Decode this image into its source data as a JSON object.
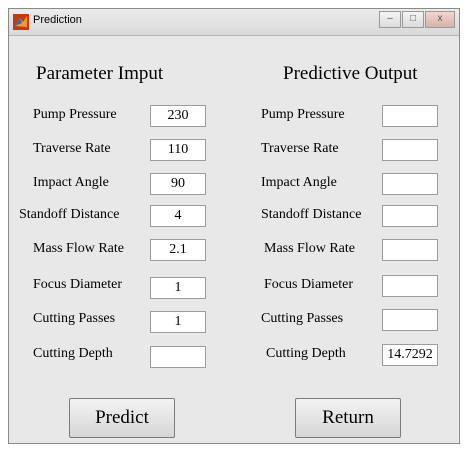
{
  "window": {
    "title": "Prediction"
  },
  "titlebar_buttons": {
    "minimize": "–",
    "maximize": "□",
    "close": "x"
  },
  "input": {
    "heading": "Parameter Imput",
    "rows": [
      {
        "label": "Pump Pressure",
        "value": "230"
      },
      {
        "label": "Traverse Rate",
        "value": "110"
      },
      {
        "label": "Impact Angle",
        "value": "90"
      },
      {
        "label": "Standoff Distance",
        "value": "4"
      },
      {
        "label": "Mass Flow Rate",
        "value": "2.1"
      },
      {
        "label": "Focus Diameter",
        "value": "1"
      },
      {
        "label": "Cutting Passes",
        "value": "1"
      },
      {
        "label": "Cutting Depth",
        "value": ""
      }
    ]
  },
  "output": {
    "heading": "Predictive Output",
    "rows": [
      {
        "label": "Pump Pressure",
        "value": ""
      },
      {
        "label": "Traverse Rate",
        "value": ""
      },
      {
        "label": "Impact Angle",
        "value": ""
      },
      {
        "label": "Standoff Distance",
        "value": ""
      },
      {
        "label": "Mass Flow Rate",
        "value": ""
      },
      {
        "label": "Focus Diameter",
        "value": ""
      },
      {
        "label": "Cutting Passes",
        "value": ""
      },
      {
        "label": "Cutting Depth",
        "value": "14.7292"
      }
    ]
  },
  "buttons": {
    "predict": "Predict",
    "return": "Return"
  }
}
